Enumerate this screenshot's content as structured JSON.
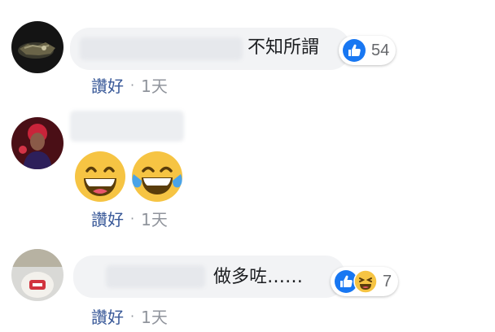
{
  "comments": [
    {
      "text": "不知所謂",
      "like_count": "54",
      "actions": {
        "like_label": "讚好",
        "separator": "·",
        "time": "1天"
      }
    },
    {
      "emojis": [
        "grinning-face-with-big-eyes",
        "face-with-tears-of-joy"
      ],
      "actions": {
        "like_label": "讚好",
        "separator": "·",
        "time": "1天"
      }
    },
    {
      "text": "做多咗……",
      "like_count": "7",
      "actions": {
        "like_label": "讚好",
        "separator": "·",
        "time": "1天"
      }
    }
  ],
  "colors": {
    "like_blue": "#1877f2",
    "bubble_bg": "#f2f3f5",
    "link": "#385898",
    "meta_gray": "#90949c"
  }
}
